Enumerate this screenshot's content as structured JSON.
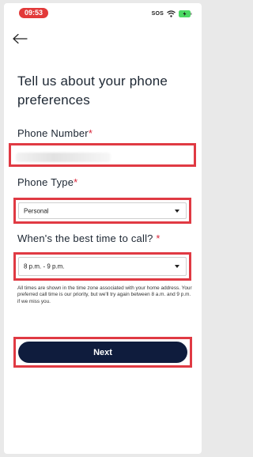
{
  "status_bar": {
    "time": "09:53",
    "sos": "SOS",
    "icons": [
      "wifi-icon",
      "battery-charging-icon"
    ]
  },
  "nav": {
    "back_icon": "arrow-left-icon"
  },
  "title": "Tell us about  your phone\npreferences",
  "phone_number": {
    "label": "Phone Number",
    "required_mark": "*",
    "value": ""
  },
  "phone_type": {
    "label": "Phone Type",
    "required_mark": "*",
    "selected": "Personal"
  },
  "best_time": {
    "label": "When's the best time to call?",
    "required_mark": "*",
    "selected": "8 p.m. - 9 p.m."
  },
  "note": "All times are shown in the time zone associated with your home address. Your preferred call time is our priority, but we'll try again between 8 a.m. and 9 p.m. if we miss you.",
  "next_button": {
    "label": "Next"
  },
  "colors": {
    "accent_red": "#e03a43",
    "button_navy": "#0f1c3d",
    "time_pill": "#e23a3a",
    "battery_green": "#4cd964"
  }
}
